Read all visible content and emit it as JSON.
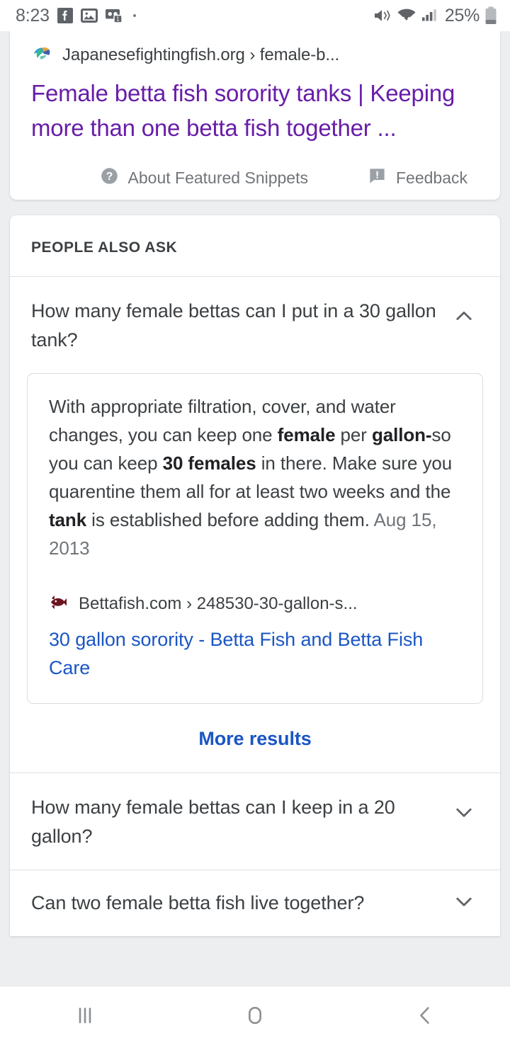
{
  "statusbar": {
    "time": "8:23",
    "battery_percent": "25%",
    "icons": [
      "facebook-icon",
      "photo-icon",
      "voicemail-icon",
      "mute-icon",
      "wifi-icon",
      "signal-icon",
      "battery-icon"
    ]
  },
  "featured_snippet": {
    "favicon": "japanesefightingfish-favicon",
    "source": "Japanesefightingfish.org › female-b...",
    "title": "Female betta fish sorority tanks | Keeping more than one betta fish together ...",
    "about_label": "About Featured Snippets",
    "feedback_label": "Feedback"
  },
  "people_also_ask": {
    "heading": "PEOPLE ALSO ASK",
    "items": [
      {
        "question": "How many female bettas can I put in a 30 gallon tank?",
        "expanded": true,
        "chevron": "chevron-up-icon",
        "answer_parts": [
          {
            "text": "With appropriate filtration, cover, and water changes, you can keep one ",
            "bold": false
          },
          {
            "text": "female",
            "bold": true
          },
          {
            "text": " per ",
            "bold": false
          },
          {
            "text": "gallon-",
            "bold": true
          },
          {
            "text": "so you can keep ",
            "bold": false
          },
          {
            "text": "30 females",
            "bold": true
          },
          {
            "text": " in there. Make sure you quarentine them all for at least two weeks and the ",
            "bold": false
          },
          {
            "text": "tank",
            "bold": true
          },
          {
            "text": " is established before adding them. ",
            "bold": false
          }
        ],
        "answer_date": "Aug 15, 2013",
        "source_favicon": "bettafish-favicon",
        "source": "Bettafish.com › 248530-30-gallon-s...",
        "link_title": "30 gallon sorority - Betta Fish and Betta Fish Care"
      },
      {
        "question": "How many female bettas can I keep in a 20 gallon?",
        "expanded": false,
        "chevron": "chevron-down-icon"
      },
      {
        "question": "Can two female betta fish live together?",
        "expanded": false,
        "chevron": "chevron-down-icon"
      }
    ],
    "more_results_label": "More results"
  },
  "navbar": {
    "recents": "recents-icon",
    "home": "home-icon",
    "back": "back-icon"
  },
  "colors": {
    "visited_link": "#681da8",
    "link": "#1a56c4",
    "text": "#3c4043",
    "muted": "#70757a",
    "page_bg": "#eceef0"
  }
}
